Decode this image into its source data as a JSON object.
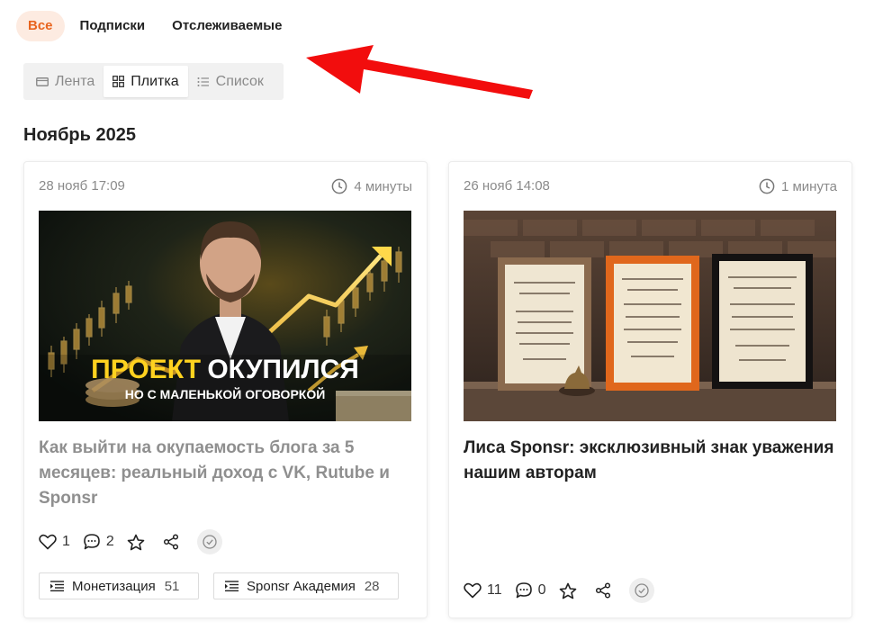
{
  "tabs": [
    {
      "label": "Все",
      "active": true
    },
    {
      "label": "Подписки",
      "active": false
    },
    {
      "label": "Отслеживаемые",
      "active": false
    }
  ],
  "view_switch": {
    "feed": "Лента",
    "tiles": "Плитка",
    "list": "Список",
    "active": "tiles"
  },
  "month_heading": "Ноябрь 2025",
  "colors": {
    "accent": "#e8641e",
    "arrow": "#f20d0d"
  },
  "cards": [
    {
      "date": "28 нояб 17:09",
      "duration": "4 минуты",
      "image_caption_1": "ПРОЕКТ",
      "image_caption_2": "ОКУПИЛСЯ",
      "image_caption_3": "НО С МАЛЕНЬКОЙ ОГОВОРКОЙ",
      "title": "Как выйти на окупаемость блога за 5 месяцев: реальный доход с VK, Rutube и Sponsr",
      "likes": "1",
      "comments": "2",
      "tags": [
        {
          "label": "Монетизация",
          "count": "51"
        },
        {
          "label": "Sponsr Академия",
          "count": "28"
        }
      ]
    },
    {
      "date": "26 нояб 14:08",
      "duration": "1 минута",
      "title": "Лиса Sponsr: эксклюзивный знак уважения нашим авторам",
      "likes": "11",
      "comments": "0",
      "tags": []
    }
  ]
}
